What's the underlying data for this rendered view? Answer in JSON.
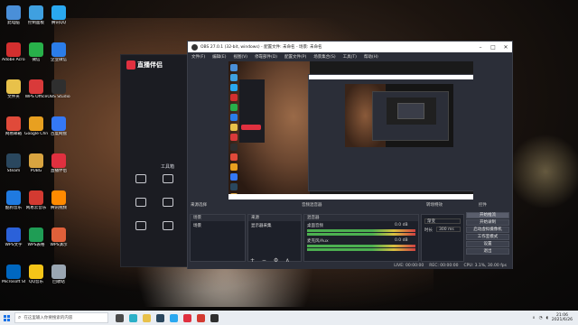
{
  "desktop": {
    "icons": [
      {
        "label": "此电脑",
        "color": "#4a8fd8"
      },
      {
        "label": "控制面板",
        "color": "#3fa0e0"
      },
      {
        "label": "腾讯QQ",
        "color": "#2aa8f0"
      },
      {
        "label": "Adobe Acrobat",
        "color": "#d32f2f"
      },
      {
        "label": "微信",
        "color": "#28b04a"
      },
      {
        "label": "企业微信",
        "color": "#2b7de9"
      },
      {
        "label": "文件夹",
        "color": "#e8c14a"
      },
      {
        "label": "WPS Office",
        "color": "#d93a3a"
      },
      {
        "label": "OBS Studio",
        "color": "#2f2f2f"
      },
      {
        "label": "网易邮箱",
        "color": "#e04a3a"
      },
      {
        "label": "Google Chrome",
        "color": "#e8a020"
      },
      {
        "label": "百度网盘",
        "color": "#3478f6"
      },
      {
        "label": "Steam",
        "color": "#2a475e"
      },
      {
        "label": "PUBG",
        "color": "#d9a440"
      },
      {
        "label": "直播伴侣",
        "color": "#e0303f"
      },
      {
        "label": "酷狗音乐",
        "color": "#1f7ae0"
      },
      {
        "label": "网易云音乐",
        "color": "#d33a31"
      },
      {
        "label": "腾讯视频",
        "color": "#ff8a00"
      },
      {
        "label": "WPS文字",
        "color": "#2b61d9"
      },
      {
        "label": "WPS表格",
        "color": "#1f9d55"
      },
      {
        "label": "WPS演示",
        "color": "#e0603a"
      },
      {
        "label": "Microsoft Store",
        "color": "#0067c0"
      },
      {
        "label": "QQ音乐",
        "color": "#f5c518"
      },
      {
        "label": "回收站",
        "color": "#9aa6b2"
      }
    ]
  },
  "stream_app": {
    "title": "直播伴侣",
    "menu_rows": [
      "",
      "",
      "",
      ""
    ],
    "tools_title": "工具箱",
    "tools": [
      "",
      "",
      "",
      "",
      "",
      ""
    ],
    "bottom": [
      "",
      ""
    ]
  },
  "obs": {
    "title": "OBS 27.0.1 (32-bit, windows) - 配置文件: 未命名 - 场景: 未命名",
    "menu": [
      "文件(F)",
      "编辑(E)",
      "视图(V)",
      "停靠部件(D)",
      "配置文件(P)",
      "场景集合(S)",
      "工具(T)",
      "帮助(H)"
    ],
    "window_buttons": {
      "min": "–",
      "max": "□",
      "close": "✕"
    },
    "dock_titles": {
      "scene_source": "来源选择",
      "mixer": "音频混音器",
      "transitions": "转场特效",
      "controls": "控件"
    },
    "scenes": {
      "header": "场景",
      "items": [
        "场景"
      ]
    },
    "sources": {
      "header": "来源",
      "items": [
        "显示器采集"
      ]
    },
    "mixer": {
      "header": "混音器",
      "channels": [
        {
          "name": "桌面音频",
          "db": "0.0 dB"
        },
        {
          "name": "麦克风/Aux",
          "db": "0.0 dB"
        }
      ]
    },
    "transitions": {
      "type_label": "渐变",
      "duration_label": "时长",
      "duration_value": "300 ms"
    },
    "controls": [
      "开始推流",
      "开始录制",
      "启动虚拟摄像机",
      "工作室模式",
      "设置",
      "退出"
    ],
    "status": {
      "live": "LIVE: 00:00:00",
      "rec": "REC: 00:00:00",
      "cpu": "CPU: 3.1%, 30.00 fps"
    }
  },
  "taskbar": {
    "search_placeholder": "在这里输入你要搜索的内容",
    "apps": [
      {
        "name": "task-view",
        "color": "#4a4a4a"
      },
      {
        "name": "edge",
        "color": "#2bb0c8"
      },
      {
        "name": "file-explorer",
        "color": "#e8c14a"
      },
      {
        "name": "steam",
        "color": "#2a475e"
      },
      {
        "name": "qq",
        "color": "#2aa8f0"
      },
      {
        "name": "streaming",
        "color": "#e0303f"
      },
      {
        "name": "netease-music",
        "color": "#d33a31"
      },
      {
        "name": "obs",
        "color": "#2f2f2f"
      }
    ],
    "time": "21:06",
    "date": "2021/6/26"
  }
}
